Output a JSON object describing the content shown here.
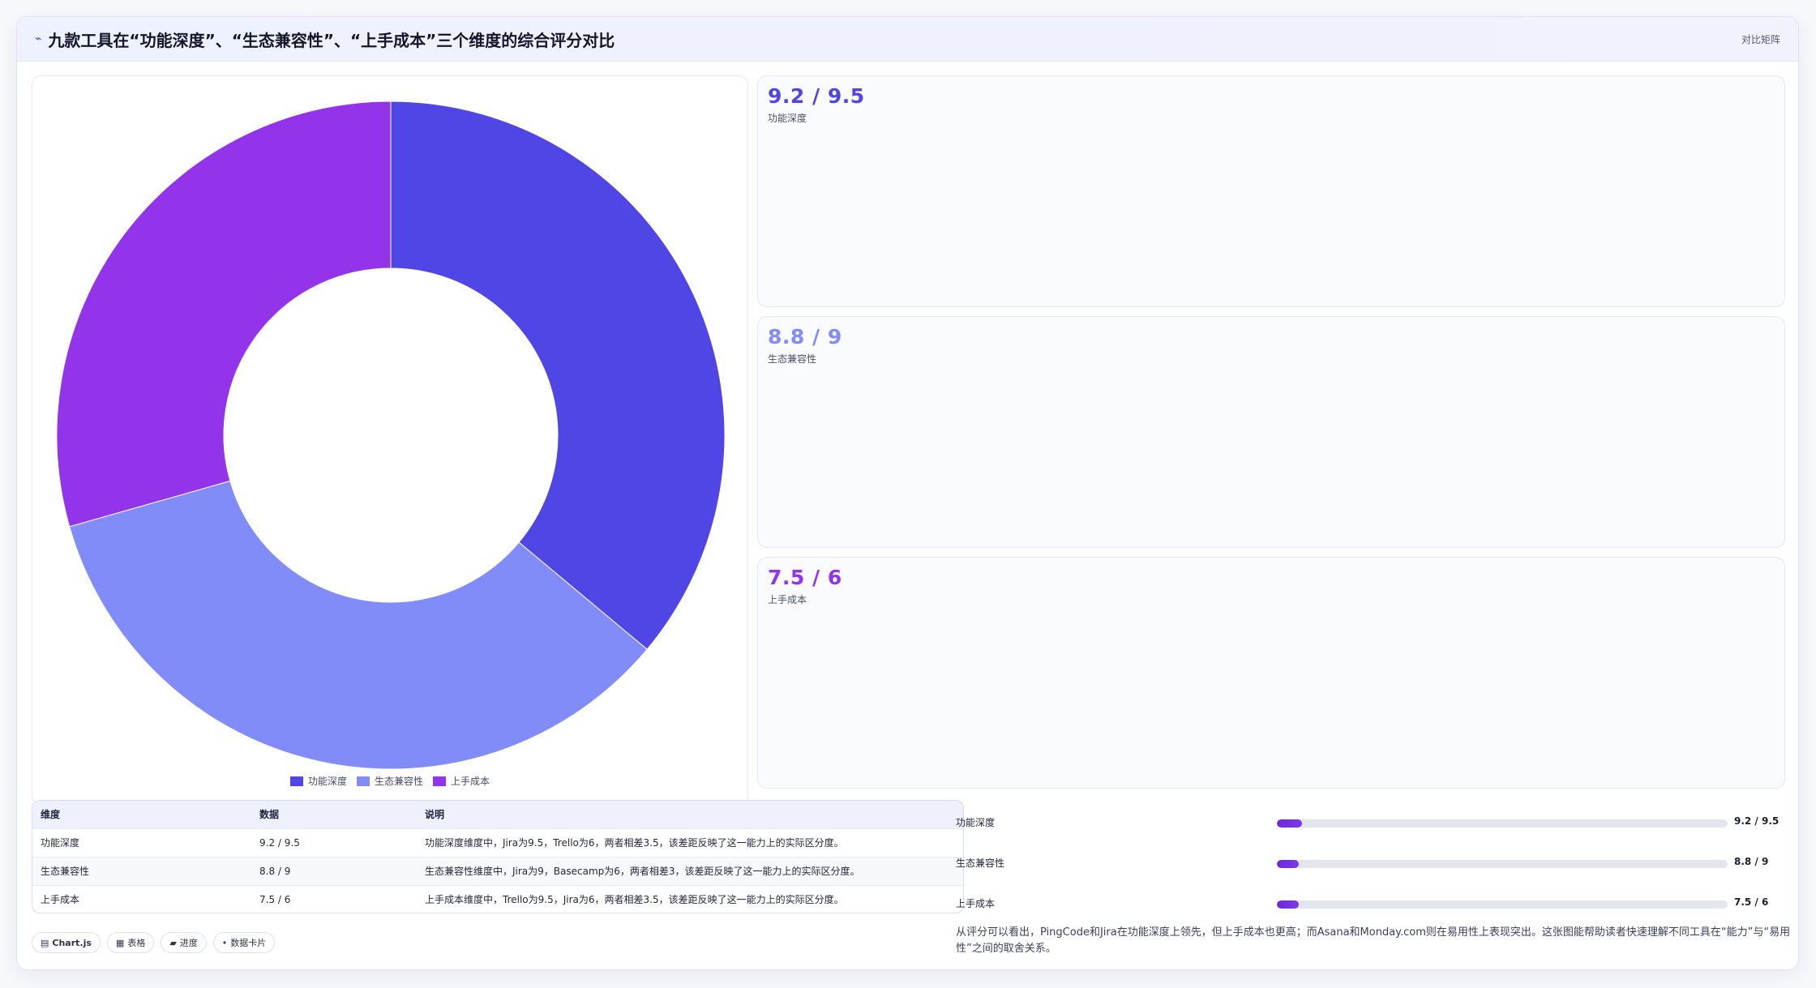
{
  "header": {
    "title": "九款工具在“功能深度”、“生态兼容性”、“上手成本”三个维度的综合评分对比",
    "icon": "chart-line-icon",
    "right_tag": "对比矩阵"
  },
  "chart_data": {
    "type": "pie",
    "categories": [
      "功能深度",
      "生态兼容性",
      "上手成本"
    ],
    "values": [
      9.2,
      8.8,
      7.5
    ],
    "colors": [
      "#4f46e5",
      "#818cf8",
      "#9333ea"
    ],
    "donut": true,
    "legend": "bottom",
    "legend_labels": [
      "功能深度",
      "生态兼容性",
      "上手成本"
    ]
  },
  "stats": [
    {
      "value": "9.2 / 9.5",
      "label": "功能深度",
      "color": "#4f46e5"
    },
    {
      "value": "8.8 / 9",
      "label": "生态兼容性",
      "color": "#818cf8"
    },
    {
      "value": "7.5 / 6",
      "label": "上手成本",
      "color": "#9333ea"
    }
  ],
  "table": {
    "headers": [
      "维度",
      "数据",
      "说明"
    ],
    "rows": [
      [
        "功能深度",
        "9.2 / 9.5",
        "功能深度维度中，Jira为9.5，Trello为6，两者相差3.5，该差距反映了这一能力上的实际区分度。"
      ],
      [
        "生态兼容性",
        "8.8 / 9",
        "生态兼容性维度中，Jira为9，Basecamp为6，两者相差3，该差距反映了这一能力上的实际区分度。"
      ],
      [
        "上手成本",
        "7.5 / 6",
        "上手成本维度中，Trello为9.5，Jira为6，两者相差3.5，该差距反映了这一能力上的实际区分度。"
      ]
    ]
  },
  "pills": [
    {
      "icon": "grid-icon",
      "glyph": "▤",
      "label": "Chart.js"
    },
    {
      "icon": "table-icon",
      "glyph": "▦",
      "label": "表格"
    },
    {
      "icon": "progress-icon",
      "glyph": "▰",
      "label": "进度"
    },
    {
      "icon": "dot-icon",
      "glyph": "•",
      "label": "数据卡片"
    }
  ],
  "progress": [
    {
      "label": "功能深度",
      "value": "9.2 / 9.5",
      "fill": 0.055
    },
    {
      "label": "生态兼容性",
      "value": "8.8 / 9",
      "fill": 0.048
    },
    {
      "label": "上手成本",
      "value": "7.5 / 6",
      "fill": 0.048
    }
  ],
  "summary": "从评分可以看出，PingCode和Jira在功能深度上领先，但上手成本也更高；而Asana和Monday.com则在易用性上表现突出。这张图能帮助读者快速理解不同工具在“能力”与“易用性”之间的取舍关系。"
}
